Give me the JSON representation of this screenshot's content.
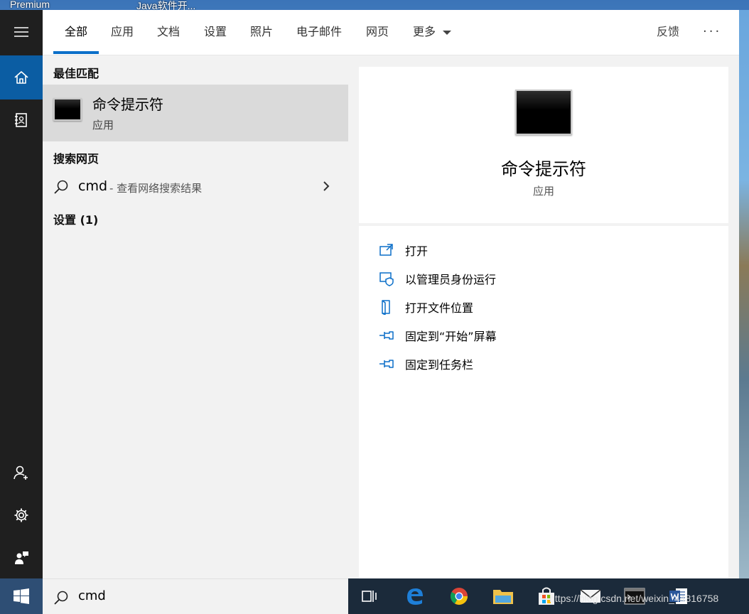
{
  "desktop": {
    "left_text": "Premium",
    "right_text": "Java软件开..."
  },
  "tabs": [
    {
      "label": "全部",
      "active": true
    },
    {
      "label": "应用"
    },
    {
      "label": "文档"
    },
    {
      "label": "设置"
    },
    {
      "label": "照片"
    },
    {
      "label": "电子邮件"
    },
    {
      "label": "网页"
    },
    {
      "label": "更多"
    }
  ],
  "header": {
    "feedback_label": "反馈",
    "more_icon": "ellipsis-icon"
  },
  "results": {
    "best_match_title": "最佳匹配",
    "best_match": {
      "name": "命令提示符",
      "type": "应用"
    },
    "web_title": "搜索网页",
    "web_item": {
      "query": "cmd",
      "suffix": "- 查看网络搜索结果"
    },
    "settings_title": "设置 (1)"
  },
  "detail": {
    "name": "命令提示符",
    "type": "应用",
    "actions": [
      {
        "label": "打开",
        "icon": "open-icon"
      },
      {
        "label": "以管理员身份运行",
        "icon": "shield-icon"
      },
      {
        "label": "打开文件位置",
        "icon": "file-location-icon"
      },
      {
        "label": "固定到“开始”屏幕",
        "icon": "pin-icon"
      },
      {
        "label": "固定到任务栏",
        "icon": "pin-icon"
      }
    ]
  },
  "search": {
    "value": "cmd"
  },
  "watermark": "https://blog.csdn.net/weixin_44816758",
  "colors": {
    "accent": "#0b6fc9",
    "rail_bg": "#1f1f1f",
    "rail_active": "#0b5da3",
    "panel_bg": "#f2f2f2",
    "selected_bg": "#dadada"
  }
}
